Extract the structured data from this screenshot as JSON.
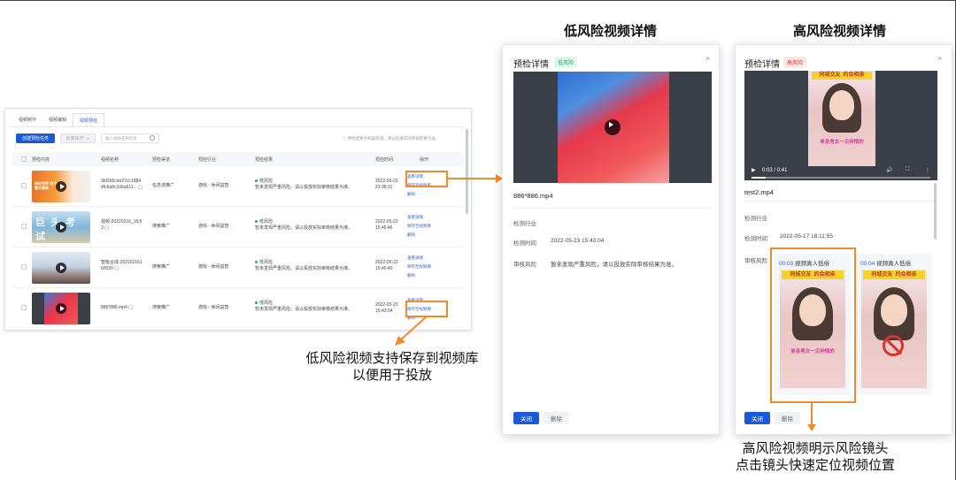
{
  "headings": {
    "low_risk": "低风险视频详情",
    "high_risk": "高风险视频详情"
  },
  "list": {
    "tabs": [
      "视频制作",
      "视频编辑",
      "视频预检"
    ],
    "create_button": "创建预检任务",
    "bulk_button": "批量操作",
    "search_placeholder": "输入视频名称检索",
    "tip": "预检结果为机器检测，请以投放实际审核结果为准。",
    "columns": [
      "预检内容",
      "视频名称",
      "预检渠道",
      "预检行业",
      "预检结果",
      "预检时间",
      "操作"
    ],
    "rows": [
      {
        "name1": "3bf2b5cde27cc1884",
        "name2": "4fc6a8c10ba611...",
        "channel": "信息流推广",
        "industry": "游戏 - 休闲益智",
        "result": "低风险",
        "desc": "暂未发现严重风险，请以投放实际审核结果为准。",
        "date": "2022-05-23",
        "time": "21:38:31",
        "ops": [
          "查看详情",
          "保存至视频库",
          "删除"
        ],
        "thumb_text": "你好世界·东方 · 奢华美味"
      },
      {
        "name1": "视频-20220216_15:5",
        "name2": "3",
        "channel": "搜索推广",
        "industry": "游戏 - 休闲益智",
        "result": "低风险",
        "desc": "暂未发现严重风险，请以投放实际审核结果为准。",
        "date": "2022-05-23",
        "time": "15:45:46",
        "ops": [
          "查看详情",
          "保存至视频库",
          "删除"
        ],
        "thumb_text": "巨头考试"
      },
      {
        "name1": "智能合成-202202161",
        "name2": "60020",
        "channel": "搜索推广",
        "industry": "游戏 - 休闲益智",
        "result": "低风险",
        "desc": "暂未发现严重风险，请以投放实际审核结果为准。",
        "date": "2022-05-23",
        "time": "15:45:40",
        "ops": [
          "查看详情",
          "保存至视频库",
          "删除"
        ],
        "thumb_text": ""
      },
      {
        "name1": "886*886.mp4",
        "name2": "",
        "channel": "搜索推广",
        "industry": "游戏 - 休闲益智",
        "result": "低风险",
        "desc": "暂未发现严重风险，请以投放实际审核结果为准。",
        "date": "2022-05-23",
        "time": "15:43:04",
        "ops": [
          "查看详情",
          "保存至视频库",
          "删除"
        ],
        "thumb_text": ""
      }
    ]
  },
  "captions": {
    "low": [
      "低风险视频支持保存到视频库",
      "以便用于投放"
    ],
    "high": [
      "高风险视频明示风险镜头",
      "点击镜头快速定位视频位置"
    ]
  },
  "low_dialog": {
    "title": "预检详情",
    "badge": "低风险",
    "filename": "886*886.mp4",
    "labels": {
      "industry": "检测行业",
      "time": "检测时间",
      "risk": "审核风险"
    },
    "time_value": "2022-05-23 15:43:04",
    "risk_value": "暂未发现严重风险，请以投放实际审核结果为准。",
    "buttons": {
      "close": "关闭",
      "delete": "删除"
    }
  },
  "high_dialog": {
    "title": "预检详情",
    "badge": "高风险",
    "filename": "test2.mp4",
    "player_time": "0:03 / 0:41",
    "labels": {
      "industry": "检测行业",
      "time": "检测时间",
      "risk": "审核风险"
    },
    "time_value": "2022-05-17 18:11:55",
    "banner_left": "同城交友",
    "banner_right": "约会相亲",
    "overlay_text": "单身男女一见钟情的",
    "shots": [
      {
        "time": "00:03",
        "label": "视频真人低俗"
      },
      {
        "time": "00:04",
        "label": "视频真人低俗"
      }
    ],
    "buttons": {
      "close": "关闭",
      "delete": "删除"
    }
  },
  "colors": {
    "accent": "#1a5ad7",
    "highlight": "#f08a2c",
    "low": "#2ba86a",
    "high": "#d8332d"
  }
}
